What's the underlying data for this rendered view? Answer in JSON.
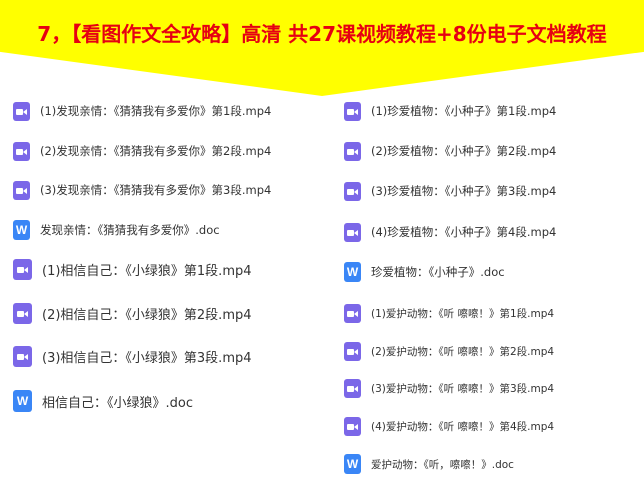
{
  "banner": {
    "title": "7，【看图作文全攻略】高清 共27课视频教程+8份电子文档教程"
  },
  "left_files": [
    {
      "icon": "video-icon",
      "name": "(1)发现亲情：《猜猜我有多爱你》第1段.mp4"
    },
    {
      "icon": "video-icon",
      "name": "(2)发现亲情：《猜猜我有多爱你》第2段.mp4"
    },
    {
      "icon": "video-icon",
      "name": "(3)发现亲情：《猜猜我有多爱你》第3段.mp4"
    },
    {
      "icon": "word-doc-icon",
      "name": "发现亲情：《猜猜我有多爱你》.doc"
    },
    {
      "icon": "video-icon",
      "name": "(1)相信自己：《小绿狼》第1段.mp4"
    },
    {
      "icon": "video-icon",
      "name": "(2)相信自己：《小绿狼》第2段.mp4"
    },
    {
      "icon": "video-icon",
      "name": "(3)相信自己：《小绿狼》第3段.mp4"
    },
    {
      "icon": "word-doc-icon",
      "name": "相信自己：《小绿狼》.doc"
    }
  ],
  "right_files": [
    {
      "icon": "video-icon",
      "name": "(1)珍爱植物：《小种子》第1段.mp4"
    },
    {
      "icon": "video-icon",
      "name": "(2)珍爱植物：《小种子》第2段.mp4"
    },
    {
      "icon": "video-icon",
      "name": "(3)珍爱植物：《小种子》第3段.mp4"
    },
    {
      "icon": "video-icon",
      "name": "(4)珍爱植物：《小种子》第4段.mp4"
    },
    {
      "icon": "word-doc-icon",
      "name": "珍爱植物：《小种子》.doc"
    },
    {
      "icon": "video-icon",
      "name": "(1)爱护动物：《听 嚓嚓！》第1段.mp4"
    },
    {
      "icon": "video-icon",
      "name": "(2)爱护动物：《听 嚓嚓！》第2段.mp4"
    },
    {
      "icon": "video-icon",
      "name": "(3)爱护动物：《听 嚓嚓！》第3段.mp4"
    },
    {
      "icon": "video-icon",
      "name": "(4)爱护动物：《听 嚓嚓！》第4段.mp4"
    },
    {
      "icon": "word-doc-icon",
      "name": "爱护动物：《听，嚓嚓！》.doc"
    }
  ],
  "colors": {
    "banner": "#ffff00",
    "title": "#e60012",
    "video_icon": "#7b67e8",
    "doc_icon": "#3a86f6"
  }
}
